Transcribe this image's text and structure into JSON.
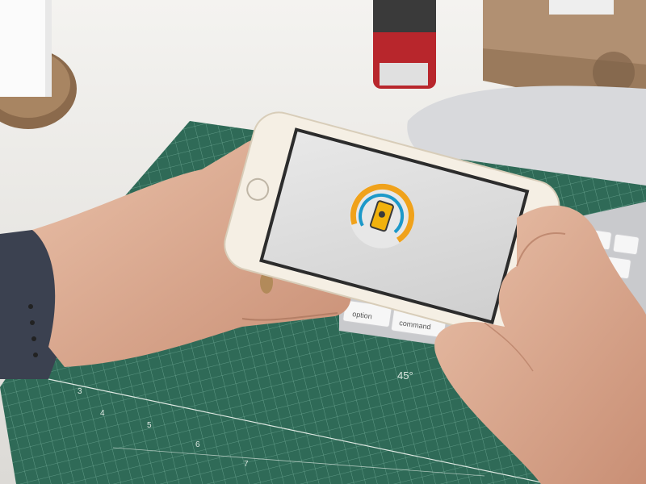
{
  "scene": {
    "description_visible_text": {
      "keyboard_key_option": "option",
      "keyboard_key_command": "command",
      "mat_angle_label": "45°",
      "mat_ruler_numbers": [
        "3",
        "4",
        "5",
        "6",
        "7"
      ]
    }
  },
  "colors": {
    "desk": "#ecebe8",
    "mat": "#2f6a57",
    "mat_grid": "#7fb2a0",
    "phone_body": "#f5efe4",
    "phone_screen": "#d9d9d9",
    "ring_orange": "#f0a21b",
    "ring_blue": "#1d99c9",
    "icon_phone": "#f2b20d",
    "watch_band": "#3b4150",
    "skin": "#e3b59c",
    "box_wood": "#a9896a",
    "jar_red": "#b8262c"
  },
  "app_icon": {
    "name": "phone-location-app-icon"
  }
}
